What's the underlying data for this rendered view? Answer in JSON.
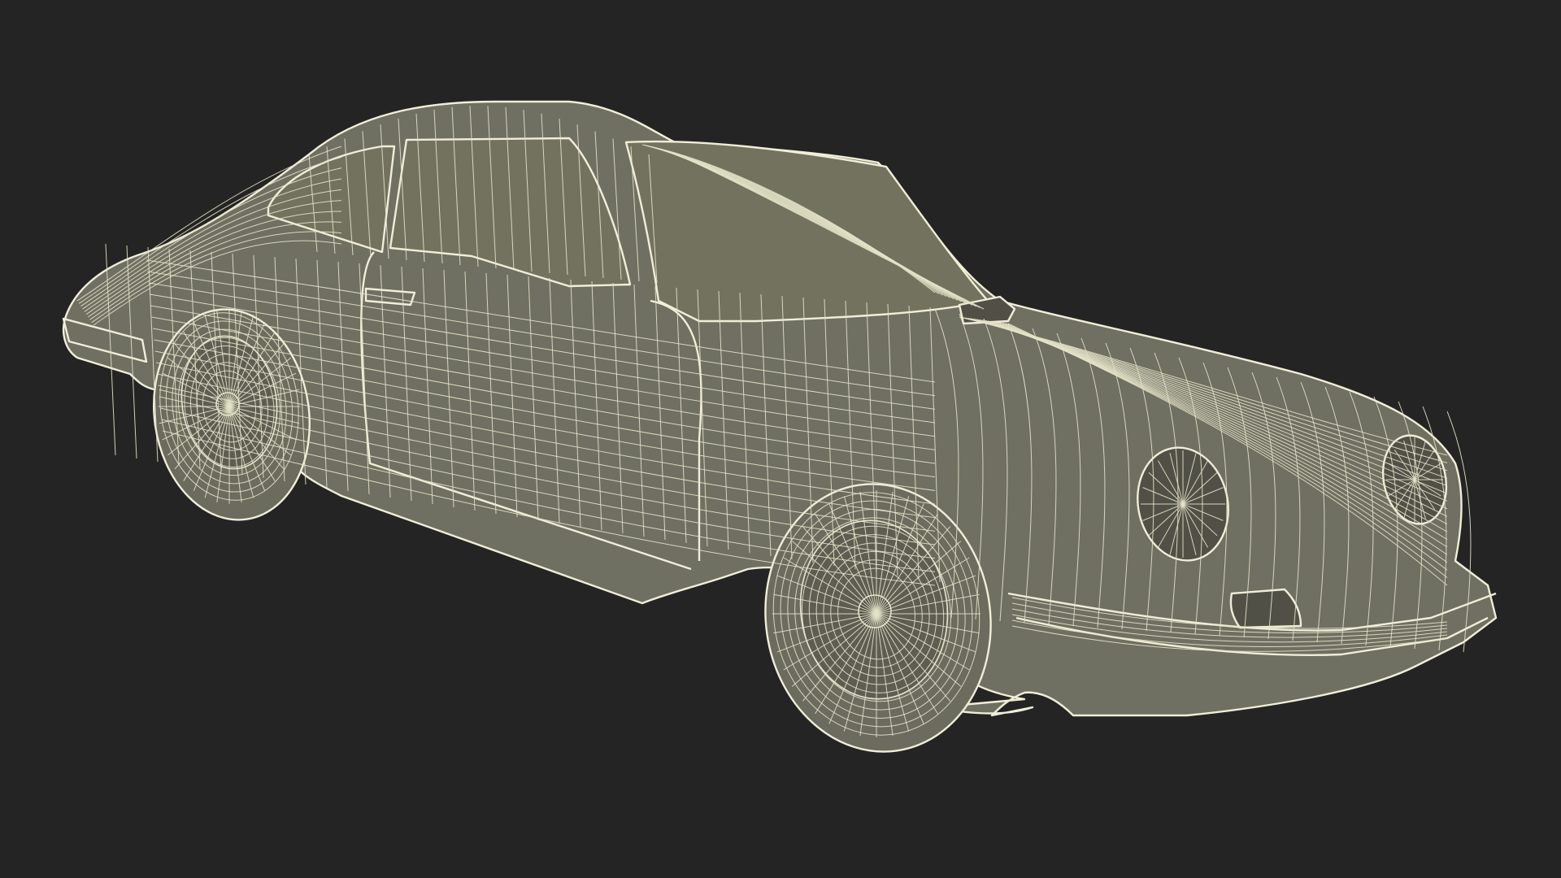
{
  "scene": {
    "subject": "car-wireframe-render",
    "background_color": "#242424",
    "surface_color": "#6f6f62",
    "wire_color": "#e8e6cf"
  }
}
